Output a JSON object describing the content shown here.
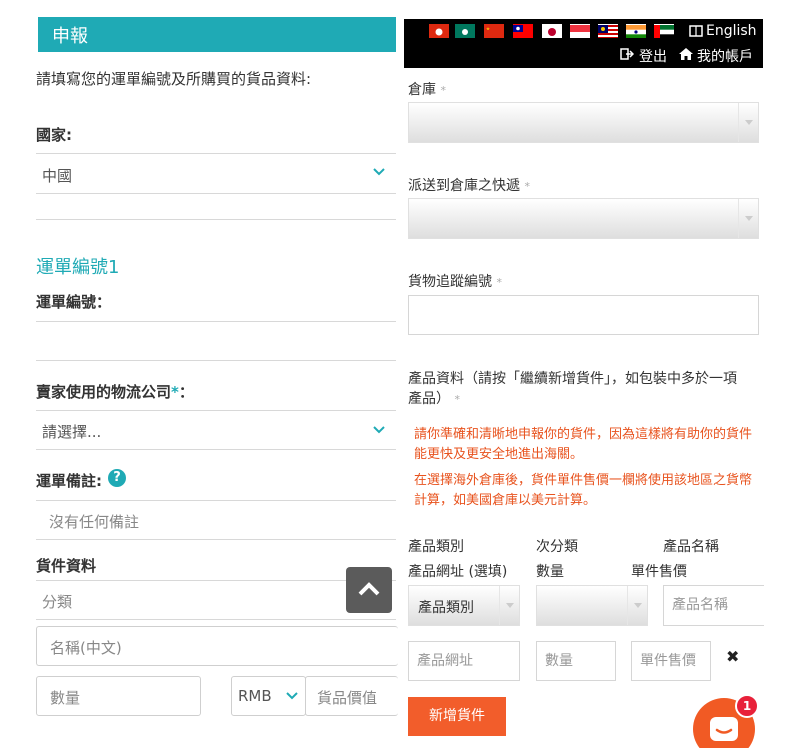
{
  "left": {
    "header_title": "申報",
    "instruction": "請填寫您的運單編號及所購買的貨品資料:",
    "country_label": "國家:",
    "country_value": "中國",
    "waybill_title": "運單編號1",
    "waybill_no_label": "運單編號：",
    "logistics_label": "賣家使用的物流公司",
    "logistics_required_mark": "*",
    "logistics_colon": "：",
    "logistics_value": "請選擇...",
    "remark_label": "運單備註:",
    "remark_help": "?",
    "remark_value": "沒有任何備註",
    "goods_label": "貨件資料",
    "category_placeholder": "分類",
    "name_placeholder": "名稱(中文)",
    "qty_placeholder": "數量",
    "currency_value": "RMB",
    "value_placeholder": "貨品價值"
  },
  "topbar": {
    "language": "English",
    "logout": "登出",
    "account": "我的帳戶"
  },
  "right": {
    "warehouse_label": "倉庫",
    "courier_label": "派送到倉庫之快遞",
    "tracking_label": "貨物追蹤編號",
    "product_info_line1": "產品資料（請按「繼續新增貨件」，如包裝中多於一項",
    "product_info_line2": "產品）",
    "required_mark": "*",
    "notice1_line1": "請你準確和清晰地申報你的貨件，因為這樣將有助你的貨件",
    "notice1_line2": "能更快及更安全地進出海關。",
    "notice2_line1": "在選擇海外倉庫後，貨件單件售價一欄將使用該地區之貨幣",
    "notice2_line2": "計算，如美國倉庫以美元計算。",
    "col_category": "產品類別",
    "col_subcategory": "次分類",
    "col_product_name": "產品名稱",
    "col_url": "產品網址 (選填)",
    "col_qty": "數量",
    "col_unit_price": "單件售價",
    "category_select": "產品類別",
    "product_name_placeholder": "產品名稱",
    "url_placeholder": "產品網址",
    "qty_placeholder": "數量",
    "unit_price_placeholder": "單件售價",
    "remove_glyph": "✖",
    "add_button": "新增貨件"
  },
  "chat": {
    "badge_count": "1"
  },
  "colors": {
    "teal": "#1faab5",
    "orange": "#f25d2b",
    "notice": "#e8531e",
    "topbar": "#000000"
  },
  "icons": [
    "chevron-down-icon",
    "question-icon",
    "chevron-up-icon",
    "book-icon",
    "logout-icon",
    "home-icon",
    "remove-icon",
    "chat-icon"
  ]
}
